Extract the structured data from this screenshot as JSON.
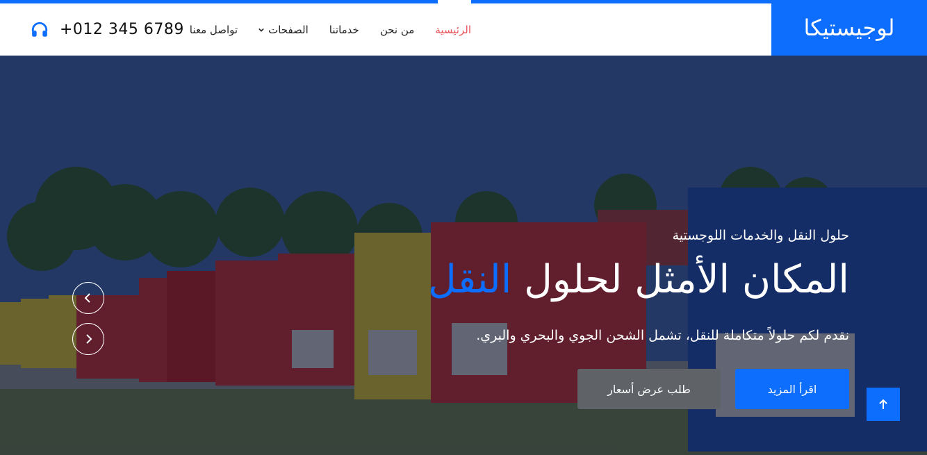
{
  "brand": {
    "name": "لوجيستيكا"
  },
  "nav": {
    "items": [
      {
        "label": "الرئيسية",
        "active": true
      },
      {
        "label": "من نحن"
      },
      {
        "label": "خدماتنا"
      },
      {
        "label": "الصفحات",
        "dropdown": true
      },
      {
        "label": "تواصل معنا"
      }
    ],
    "phone": "+012 345 6789"
  },
  "hero": {
    "subtitle": "حلول النقل والخدمات اللوجستية",
    "title_main": "المكان الأمثل لحلول ",
    "title_accent": "النقل",
    "description": "نقدم لكم حلولاً متكاملة للنقل، تشمل الشحن الجوي والبحري والبري.",
    "primary_button": "اقرأ المزيد",
    "secondary_button": "طلب عرض أسعار"
  },
  "icons": {
    "phone": "headphone-icon",
    "prev": "chevron-left-icon",
    "next": "chevron-right-icon",
    "back_to_top": "arrow-up-icon",
    "dropdown": "chevron-down-icon"
  },
  "colors": {
    "accent": "#0d6efd",
    "active_nav": "#e8545a",
    "secondary_button": "#5f6368"
  }
}
